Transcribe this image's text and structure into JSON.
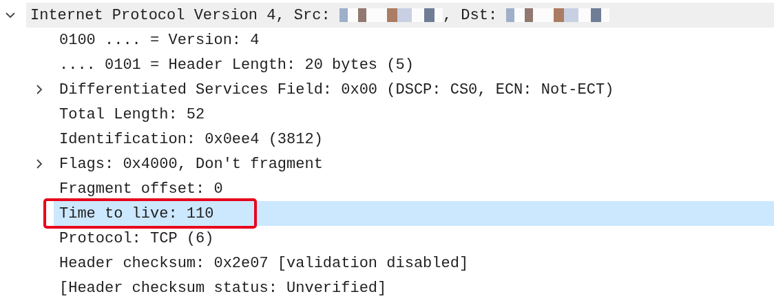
{
  "tree": [
    {
      "kind": "branch",
      "expanded": true,
      "selected": false,
      "hovered": true,
      "parts": [
        {
          "kind": "text",
          "text": "Internet Protocol Version 4, Src: "
        },
        {
          "kind": "redacted"
        },
        {
          "kind": "text",
          "text": ", Dst: "
        },
        {
          "kind": "redacted"
        }
      ],
      "children": [
        {
          "kind": "leaf",
          "label": "0100 .... = Version: 4",
          "selected": false,
          "annotated": false
        },
        {
          "kind": "leaf",
          "label": ".... 0101 = Header Length: 20 bytes (5)",
          "selected": false,
          "annotated": false
        },
        {
          "kind": "branch",
          "expanded": false,
          "label": "Differentiated Services Field: 0x00 (DSCP: CS0, ECN: Not-ECT)",
          "selected": false,
          "annotated": false
        },
        {
          "kind": "leaf",
          "label": "Total Length: 52",
          "selected": false,
          "annotated": false
        },
        {
          "kind": "leaf",
          "label": "Identification: 0x0ee4 (3812)",
          "selected": false,
          "annotated": false
        },
        {
          "kind": "branch",
          "expanded": false,
          "label": "Flags: 0x4000, Don't fragment",
          "selected": false,
          "annotated": false
        },
        {
          "kind": "leaf",
          "label": "Fragment offset: 0",
          "selected": false,
          "annotated": false
        },
        {
          "kind": "leaf",
          "label": "Time to live: 110",
          "selected": true,
          "annotated": true
        },
        {
          "kind": "leaf",
          "label": "Protocol: TCP (6)",
          "selected": false,
          "annotated": false
        },
        {
          "kind": "leaf",
          "label": "Header checksum: 0x2e07 [validation disabled]",
          "selected": false,
          "annotated": false
        },
        {
          "kind": "leaf",
          "label": "[Header checksum status: Unverified]",
          "selected": false,
          "annotated": false
        }
      ]
    }
  ]
}
